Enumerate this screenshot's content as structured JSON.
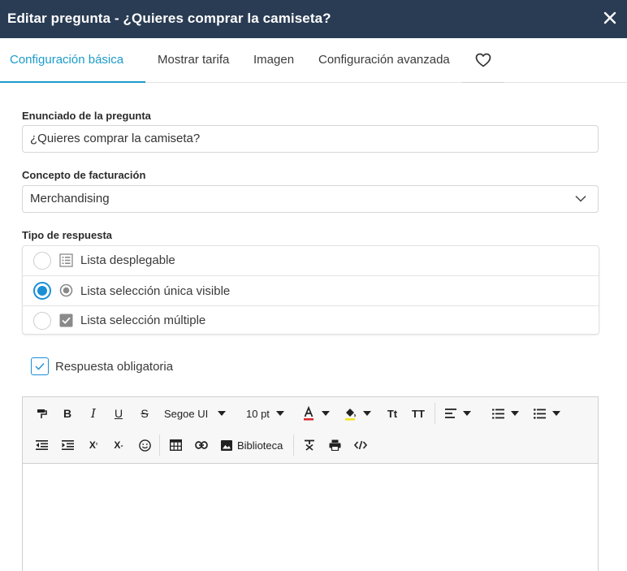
{
  "header": {
    "title": "Editar pregunta - ¿Quieres comprar la camiseta?",
    "close_icon": "close-icon"
  },
  "tabs": [
    {
      "label": "Configuración básica",
      "active": true
    },
    {
      "label": "Mostrar tarifa",
      "active": false
    },
    {
      "label": "Imagen",
      "active": false
    },
    {
      "label": "Configuración avanzada",
      "active": false
    },
    {
      "label": "",
      "icon": "heart-icon",
      "active": false
    }
  ],
  "form": {
    "question": {
      "label": "Enunciado de la pregunta",
      "value": "¿Quieres comprar la camiseta?"
    },
    "billing": {
      "label": "Concepto de facturación",
      "value": "Merchandising"
    },
    "response_type": {
      "label": "Tipo de respuesta",
      "options": [
        {
          "label": "Lista desplegable",
          "icon": "list-icon",
          "selected": false
        },
        {
          "label": "Lista selección única visible",
          "icon": "radio-button-icon",
          "selected": true
        },
        {
          "label": "Lista selección múltiple",
          "icon": "checkbox-icon",
          "selected": false
        }
      ]
    },
    "required": {
      "label": "Respuesta obligatoria",
      "checked": true
    }
  },
  "editor": {
    "font_family": "Segoe UI",
    "font_size": "10 pt",
    "library_label": "Biblioteca",
    "content": ""
  },
  "colors": {
    "header_bg": "#2a3c54",
    "accent": "#1b9bc9",
    "radio_blue": "#1a8fd6"
  }
}
